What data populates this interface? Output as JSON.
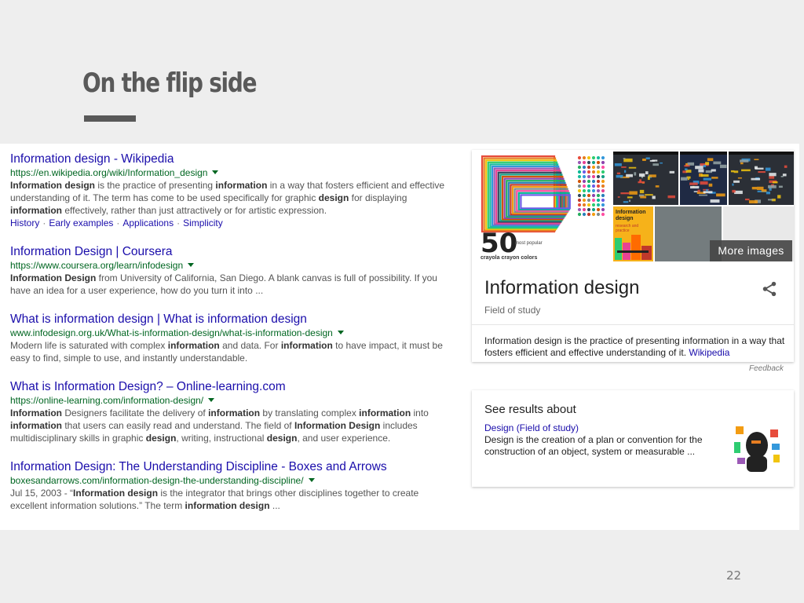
{
  "slide": {
    "title": "On the flip side",
    "page_number": "22"
  },
  "results": [
    {
      "title": "Information design - Wikipedia",
      "url": "https://en.wikipedia.org/wiki/Information_design",
      "snippet_parts": [
        {
          "t": "Information design",
          "b": true
        },
        {
          "t": " is the practice of presenting ",
          "b": false
        },
        {
          "t": "information",
          "b": true
        },
        {
          "t": " in a way that fosters efficient and effective understanding of it. The term has come to be used specifically for graphic ",
          "b": false
        },
        {
          "t": "design",
          "b": true
        },
        {
          "t": " for displaying ",
          "b": false
        },
        {
          "t": "information",
          "b": true
        },
        {
          "t": " effectively, rather than just attractively or for artistic expression.",
          "b": false
        }
      ],
      "sitelinks": [
        "History",
        "Early examples",
        "Applications",
        "Simplicity"
      ]
    },
    {
      "title": "Information Design | Coursera",
      "url": "https://www.coursera.org/learn/infodesign",
      "snippet_parts": [
        {
          "t": "Information Design",
          "b": true
        },
        {
          "t": " from University of California, San Diego. A blank canvas is full of possibility. If you have an idea for a user experience, how do you turn it into ...",
          "b": false
        }
      ]
    },
    {
      "title": "What is information design | What is information design",
      "url": "www.infodesign.org.uk/What-is-information-design/what-is-information-design",
      "snippet_parts": [
        {
          "t": "Modern life is saturated with complex ",
          "b": false
        },
        {
          "t": "information",
          "b": true
        },
        {
          "t": " and data. For ",
          "b": false
        },
        {
          "t": "information",
          "b": true
        },
        {
          "t": " to have impact, it must be easy to find, simple to use, and instantly understandable.",
          "b": false
        }
      ]
    },
    {
      "title": "What is Information Design? – Online-learning.com",
      "url": "https://online-learning.com/information-design/",
      "snippet_parts": [
        {
          "t": "Information",
          "b": true
        },
        {
          "t": " Designers facilitate the delivery of ",
          "b": false
        },
        {
          "t": "information",
          "b": true
        },
        {
          "t": " by translating complex ",
          "b": false
        },
        {
          "t": "information",
          "b": true
        },
        {
          "t": " into ",
          "b": false
        },
        {
          "t": "information",
          "b": true
        },
        {
          "t": " that users can easily read and understand. The field of ",
          "b": false
        },
        {
          "t": "Information Design",
          "b": true
        },
        {
          "t": " includes multidisciplinary skills in graphic ",
          "b": false
        },
        {
          "t": "design",
          "b": true
        },
        {
          "t": ", writing, instructional ",
          "b": false
        },
        {
          "t": "design",
          "b": true
        },
        {
          "t": ", and user experience.",
          "b": false
        }
      ]
    },
    {
      "title": "Information Design: The Understanding Discipline - Boxes and Arrows",
      "url": "boxesandarrows.com/information-design-the-understanding-discipline/",
      "snippet_parts": [
        {
          "t": "Jul 15, 2003 - “",
          "b": false
        },
        {
          "t": "Information design",
          "b": true
        },
        {
          "t": " is the integrator that brings other disciplines together to create excellent information solutions.” The term ",
          "b": false
        },
        {
          "t": "information design",
          "b": true
        },
        {
          "t": " ...",
          "b": false
        }
      ]
    }
  ],
  "knowledge_panel": {
    "title": "Information design",
    "subtitle": "Field of study",
    "description": "Information design is the practice of presenting information in a way that fosters efficient and effective understanding of it.",
    "source_link": "Wikipedia",
    "more_images": "More images",
    "feedback": "Feedback",
    "image_text": {
      "big_number": "50",
      "caption_small": "most popular",
      "caption": "crayola crayon colors",
      "book_title": "Information design",
      "book_sub": "research and practice"
    }
  },
  "see_results": {
    "heading": "See results about",
    "link": "Design (Field of study)",
    "description": "Design is the creation of a plan or convention for the construction of an object, system or measurable ..."
  },
  "colors": {
    "link": "#1a0dab",
    "url": "#006621",
    "snippet": "#545454",
    "title_grey": "#595959"
  }
}
